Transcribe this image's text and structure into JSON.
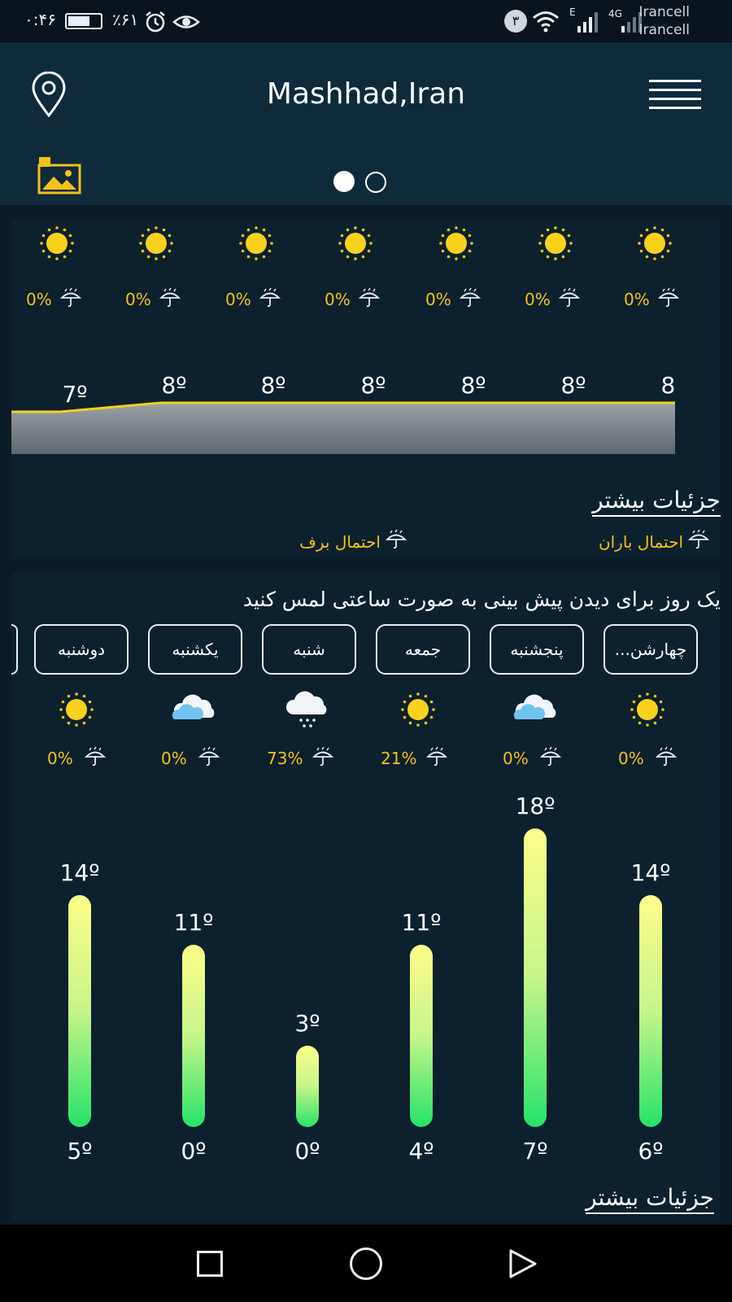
{
  "status_bar": {
    "time": "۰:۴۶",
    "battery": "٪۶۱",
    "sim_badge": "۳",
    "carrier_1": "Irancell",
    "carrier_2": "Irancell",
    "net_e": "E",
    "net_4g": "4G"
  },
  "header": {
    "title": "Mashhad,Iran",
    "icons": [
      "location-pin-icon",
      "hamburger-menu-icon",
      "locked-image-icon"
    ],
    "page_dots": {
      "count": 2,
      "active": 0
    }
  },
  "hourly": {
    "chance": [
      "0%",
      "0%",
      "0%",
      "0%",
      "0%",
      "0%",
      "0%"
    ],
    "temps": [
      "7º",
      "8º",
      "8º",
      "8º",
      "8º",
      "8º",
      "8º"
    ],
    "temp_values": [
      7,
      8,
      8,
      8,
      8,
      8,
      8
    ],
    "more_details": "جزئیات بیشتر",
    "legend_rain": "احتمال باران",
    "legend_snow": "احتمال برف"
  },
  "daily": {
    "hint": "یک روز برای دیدن پیش بینی به صورت ساعتی لمس کنید",
    "days": [
      "چهارشن...",
      "پنجشنبه",
      "جمعه",
      "شنبه",
      "یکشنبه",
      "دوشنبه"
    ],
    "conditions": [
      "sun-icon",
      "cloud-icon",
      "sun-icon",
      "snow-cloud-icon",
      "cloud-icon",
      "sun-icon"
    ],
    "chance": [
      "0%",
      "0%",
      "21%",
      "73%",
      "0%",
      "0%"
    ],
    "highs": [
      "14º",
      "18º",
      "11º",
      "3º",
      "11º",
      "14º"
    ],
    "lows": [
      "6º",
      "7º",
      "4º",
      "0º",
      "0º",
      "5º"
    ],
    "high_values": [
      14,
      18,
      11,
      3,
      11,
      14
    ],
    "low_values": [
      6,
      7,
      4,
      0,
      0,
      5
    ],
    "more_details": "جزئیات بیشتر"
  },
  "colors": {
    "accent": "#f2c319",
    "background": "#0b1b27",
    "bar_top": "#fdfd8a",
    "bar_bottom": "#26e36a"
  }
}
